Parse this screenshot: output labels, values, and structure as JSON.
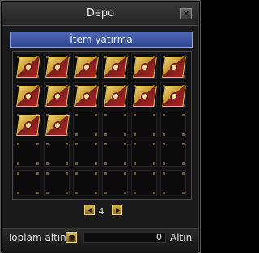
{
  "window": {
    "title": "Depo",
    "close_symbol": "×"
  },
  "tab": {
    "label": "İtem yatırma"
  },
  "inventory": {
    "slots": [
      {
        "item": "red-card-item"
      },
      {
        "item": "red-card-item"
      },
      {
        "item": "red-card-item"
      },
      {
        "item": "red-card-item"
      },
      {
        "item": "red-card-item"
      },
      {
        "item": "red-card-item"
      },
      {
        "item": "red-card-item"
      },
      {
        "item": "red-card-item"
      },
      {
        "item": "red-card-item"
      },
      {
        "item": "red-card-item"
      },
      {
        "item": "red-card-item"
      },
      {
        "item": "red-card-item"
      },
      {
        "item": "red-card-item"
      },
      {
        "item": "red-card-item"
      },
      {
        "item": null
      },
      {
        "item": null
      },
      {
        "item": null
      },
      {
        "item": null
      },
      {
        "item": null
      },
      {
        "item": null
      },
      {
        "item": null
      },
      {
        "item": null
      },
      {
        "item": null
      },
      {
        "item": null
      },
      {
        "item": null
      },
      {
        "item": null
      },
      {
        "item": null
      },
      {
        "item": null
      },
      {
        "item": null
      },
      {
        "item": null
      }
    ]
  },
  "pager": {
    "page": "4",
    "prev_icon": "left-arrow-icon",
    "next_icon": "right-arrow-icon"
  },
  "footer": {
    "total_label": "Toplam altın",
    "gold_value": "0",
    "currency_label": "Altın",
    "gold_icon": "gold-coins-icon"
  }
}
